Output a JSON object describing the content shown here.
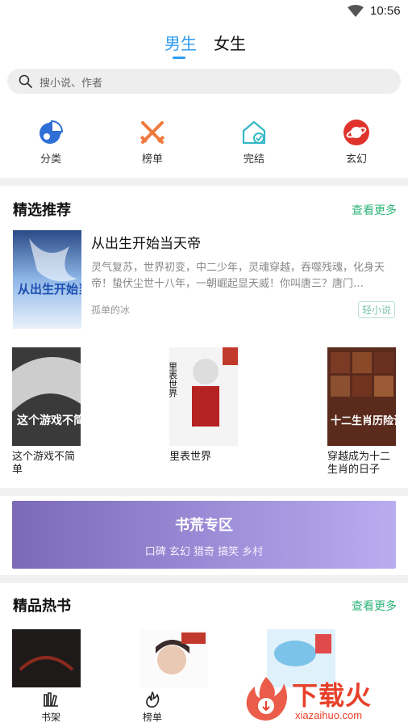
{
  "status_bar": {
    "time": "10:56"
  },
  "tabs": {
    "male": "男生",
    "female": "女生",
    "active": "male"
  },
  "search": {
    "placeholder": "搜小说、作者"
  },
  "categories": [
    {
      "label": "分类",
      "icon": "pie-chart-icon",
      "color": "#2f6fd6"
    },
    {
      "label": "榜单",
      "icon": "crossed-swords-icon",
      "color": "#f07a3c"
    },
    {
      "label": "完结",
      "icon": "house-check-icon",
      "color": "#35b8c4"
    },
    {
      "label": "玄幻",
      "icon": "planet-icon",
      "color": "#e0332b"
    }
  ],
  "featured_section": {
    "title": "精选推荐",
    "more": "查看更多",
    "main_book": {
      "title": "从出生开始当天帝",
      "description": "灵气复苏，世界初变，中二少年，灵魂穿越，吞噬残魂，化身天帝！蛰伏尘世十八年，一朝崛起显天威！你叫唐三？唐门…",
      "author": "孤单的冰",
      "tag": "轻小说",
      "cover_text": "从出生开始当天帝"
    },
    "books": [
      {
        "title": "这个游戏不简单",
        "cover_text": "这个游戏不简单"
      },
      {
        "title": "里表世界",
        "cover_text": "里表世界"
      },
      {
        "title": "穿越成为十二生肖的日子",
        "cover_text": "十二生肖历险记"
      }
    ]
  },
  "banner": {
    "title": "书荒专区",
    "subtitle": "口碑 玄幻 猎奇 搞笑 乡村"
  },
  "hot_section": {
    "title": "精品热书",
    "more": "查看更多"
  },
  "bottom_nav": [
    {
      "label": "书架",
      "icon": "bookshelf-icon"
    },
    {
      "label": "榜单",
      "icon": "flame-icon"
    }
  ],
  "watermark": {
    "big": "下载火",
    "small": "xiazaihuo.com"
  },
  "colors": {
    "accent": "#2f9bf0",
    "more_green": "#2fb57a",
    "banner_start": "#7b6ab7",
    "banner_end": "#b9acef"
  }
}
